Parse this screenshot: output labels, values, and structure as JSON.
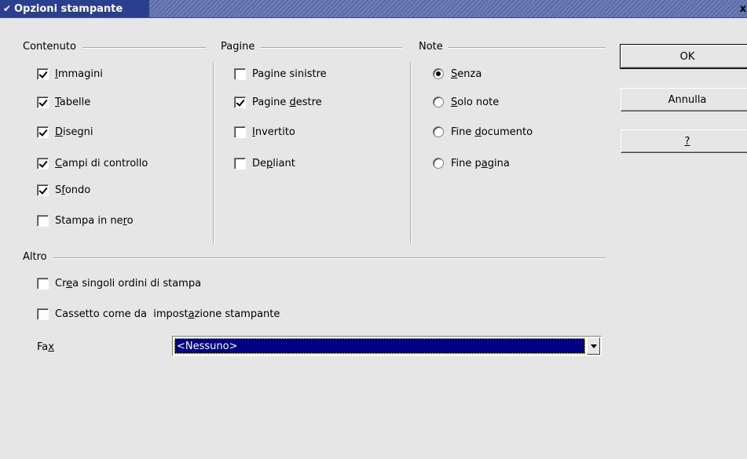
{
  "window": {
    "title": "Opzioni stampante",
    "menu_icon": "chevron-down-icon",
    "close_glyph": "x",
    "title_bg": "#2b3f8f"
  },
  "contenuto": {
    "title": "Contenuto",
    "items": [
      {
        "pre": "",
        "u": "I",
        "post": "mmagini",
        "checked": true
      },
      {
        "pre": "",
        "u": "T",
        "post": "abelle",
        "checked": true
      },
      {
        "pre": "",
        "u": "D",
        "post": "isegni",
        "checked": true
      },
      {
        "pre": "",
        "u": "C",
        "post": "ampi di controllo",
        "checked": true
      },
      {
        "pre": "S",
        "u": "f",
        "post": "ondo",
        "checked": true
      },
      {
        "pre": "Stampa in ne",
        "u": "r",
        "post": "o",
        "checked": false
      }
    ]
  },
  "pagine": {
    "title": "Pagine",
    "items": [
      {
        "pre": "Pa",
        "u": "g",
        "post": "ine sinistre",
        "checked": false
      },
      {
        "pre": "Pagine ",
        "u": "d",
        "post": "estre",
        "checked": true
      },
      {
        "pre": "",
        "u": "I",
        "post": "nvertito",
        "checked": false
      },
      {
        "pre": "De",
        "u": "p",
        "post": "liant",
        "checked": false
      }
    ]
  },
  "note": {
    "title": "Note",
    "items": [
      {
        "pre": "",
        "u": "S",
        "post": "enza",
        "selected": true
      },
      {
        "pre": "",
        "u": "S",
        "post": "olo note",
        "selected": false
      },
      {
        "pre": "Fine ",
        "u": "d",
        "post": "ocumento",
        "selected": false
      },
      {
        "pre": "Fine p",
        "u": "a",
        "post": "gina",
        "selected": false
      }
    ]
  },
  "altro": {
    "title": "Altro",
    "items": [
      {
        "pre": "Cr",
        "u": "e",
        "post": "a singoli ordini di stampa",
        "checked": false
      },
      {
        "pre": "Cassetto come da  impost",
        "u": "a",
        "post": "zione stampante",
        "checked": false
      }
    ],
    "fax": {
      "label_pre": "Fa",
      "label_u": "x",
      "label_post": "",
      "value": "<Nessuno>",
      "selection_color": "#000080"
    }
  },
  "buttons": {
    "ok": "OK",
    "cancel": "Annulla",
    "help": "?"
  }
}
